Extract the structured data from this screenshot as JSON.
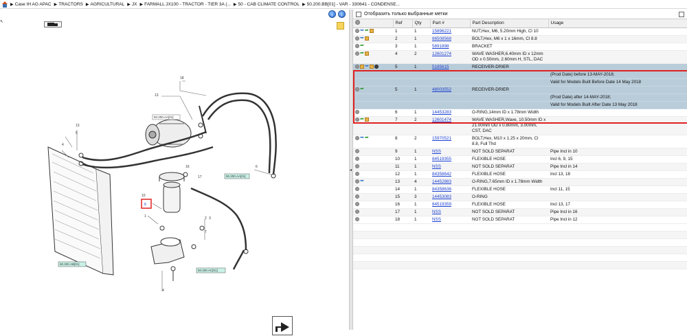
{
  "breadcrumb": {
    "items": [
      "Case IH AG APAC",
      "TRACTORS",
      "AGRICULTURAL",
      "JX",
      "FARMALL JX100 - TRACTOR - TIER 3A (...",
      "50 - CAB CLIMATE CONTROL",
      "50.200.BB[01] - VAR - 330641 - CONDENSE..."
    ]
  },
  "icons": {
    "home": "home-icon",
    "back": "arrow-left-circle-icon",
    "forward": "arrow-right-circle-icon",
    "truck": "truck-icon",
    "note": "note-icon",
    "pointer": "pointer-arrow-icon"
  },
  "diagram": {
    "callouts": [
      "1",
      "2",
      "3",
      "4",
      "5",
      "6",
      "7",
      "8",
      "9",
      "10",
      "11",
      "12",
      "13",
      "14",
      "15",
      "16",
      "17",
      "18"
    ],
    "refs": [
      "50.200.AA[01]",
      "50.200.AA[01]",
      "50.200.AB[01]",
      "50.200.AC[01]",
      "50.200.AD[01]"
    ]
  },
  "filter": {
    "label": "Отобразить только выбранные метки"
  },
  "table": {
    "headers": [
      "",
      "Ref",
      "Qty",
      "Part #",
      "Part Description",
      "Usage"
    ],
    "rows": [
      {
        "ref": "1",
        "qty": "1",
        "part": "15896221",
        "desc": "NUT,Hex, M6, 5.20mm High, Cl 10",
        "usage": ""
      },
      {
        "ref": "2",
        "qty": "1",
        "part": "86508568",
        "desc": "BOLT,Hex, M6 x 1 x 16mm, Cl 8.8",
        "usage": ""
      },
      {
        "ref": "3",
        "qty": "1",
        "part": "5891898",
        "desc": "BRACKET",
        "usage": ""
      },
      {
        "ref": "4",
        "qty": "2",
        "part": "12601274",
        "desc": "WAVE WASHER,6.40mm ID x 12mm OD x 0.50mm, 2.60mm H, STL, DAC",
        "usage": ""
      },
      {
        "ref": "5",
        "qty": "1",
        "part": "5185615",
        "desc": "RECEIVER-DRIER",
        "usage": "",
        "hl": true
      },
      {
        "ref": "",
        "qty": "",
        "part": "",
        "desc": "",
        "usage": "(Prod Date) before 13-MAY-2018;",
        "sub": true
      },
      {
        "ref": "",
        "qty": "",
        "part": "",
        "desc": "",
        "usage": "Valid for Models Built Before Date 14 May 2018",
        "sub": true
      },
      {
        "ref": "5",
        "qty": "1",
        "part": "48003552",
        "desc": "RECEIVER-DRIER",
        "usage": "",
        "hl": true
      },
      {
        "ref": "",
        "qty": "",
        "part": "",
        "desc": "",
        "usage": "(Prod Date) after 14-MAY-2018;",
        "sub": true
      },
      {
        "ref": "",
        "qty": "",
        "part": "",
        "desc": "",
        "usage": "Valid for Models Built After Date 13 May 2018",
        "sub": true
      },
      {
        "ref": "6",
        "qty": "1",
        "part": "14453283",
        "desc": "O-RING,14mm ID x 1.78mm Width",
        "usage": ""
      },
      {
        "ref": "7",
        "qty": "2",
        "part": "12601474",
        "desc": "WAVE WASHER,Wave, 10.50mm ID x 21.00mm OD x 0.80mm, 3.00mm, CST, DAC",
        "usage": ""
      },
      {
        "ref": "8",
        "qty": "2",
        "part": "15970521",
        "desc": "BOLT,Hex, M10 x 1.25 x 20mm, Cl 8.8, Full Thd",
        "usage": ""
      },
      {
        "ref": "9",
        "qty": "1",
        "part": "NSS",
        "desc": "NOT SOLD SEPARAT",
        "usage": "Pipe Incl in 10"
      },
      {
        "ref": "10",
        "qty": "1",
        "part": "84519355",
        "desc": "FLEXIBLE HOSE",
        "usage": "Incl 6, 9, 15"
      },
      {
        "ref": "11",
        "qty": "1",
        "part": "NSS",
        "desc": "NOT SOLD SEPARAT",
        "usage": "Pipe Incl in 14"
      },
      {
        "ref": "12",
        "qty": "1",
        "part": "84358642",
        "desc": "FLEXIBLE HOSE",
        "usage": "Incl 13, 18"
      },
      {
        "ref": "13",
        "qty": "4",
        "part": "14452883",
        "desc": "O-RING,7.65mm ID x 1.78mm Width",
        "usage": ""
      },
      {
        "ref": "14",
        "qty": "1",
        "part": "84358636",
        "desc": "FLEXIBLE HOSE",
        "usage": "Incl 11, 15"
      },
      {
        "ref": "15",
        "qty": "3",
        "part": "14453083",
        "desc": "O-RING",
        "usage": ""
      },
      {
        "ref": "16",
        "qty": "1",
        "part": "84519359",
        "desc": "FLEXIBLE HOSE",
        "usage": "Incl 13, 17"
      },
      {
        "ref": "17",
        "qty": "1",
        "part": "NSS",
        "desc": "NOT SOLD SEPARAT",
        "usage": "Pipe Incl in 16"
      },
      {
        "ref": "18",
        "qty": "1",
        "part": "NSS",
        "desc": "NOT SOLD SEPARAT",
        "usage": "Pipe Incl in 12"
      }
    ]
  },
  "colors": {
    "highlight": "#b9ccd9",
    "selection_border": "#e02020",
    "link": "#1a3fd0",
    "ref_label_bg": "#c9f1e6"
  }
}
